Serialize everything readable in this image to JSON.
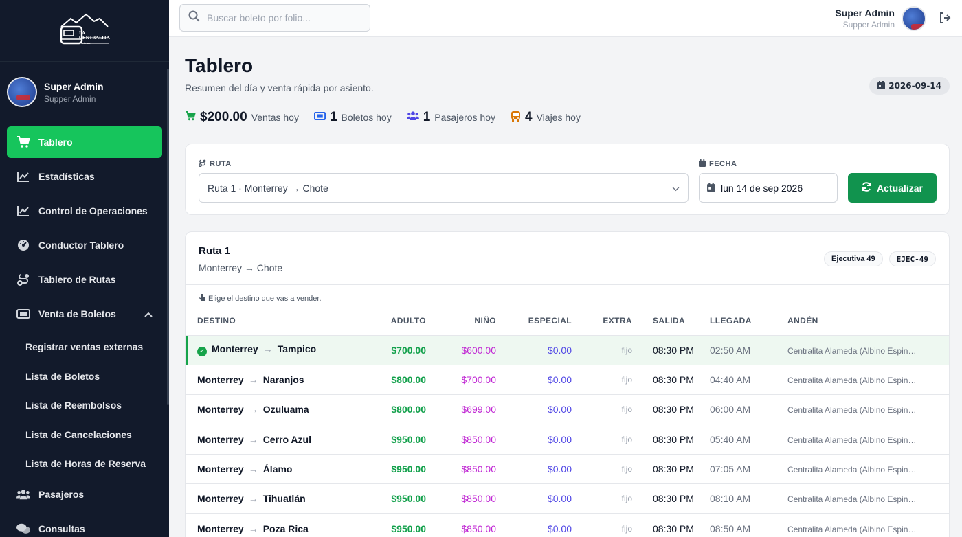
{
  "brand": {
    "logo_text_1": "LA",
    "logo_text_2": "CENTRALITA",
    "logo_text_3": "Turismo"
  },
  "sidebar": {
    "user": {
      "name": "Super Admin",
      "role": "Supper Admin"
    },
    "items": [
      {
        "label": "Tablero",
        "icon": "cart-icon",
        "active": true
      },
      {
        "label": "Estadísticas",
        "icon": "chart-line-icon"
      },
      {
        "label": "Control de Operaciones",
        "icon": "chart-line-icon"
      },
      {
        "label": "Conductor Tablero",
        "icon": "gauge-icon"
      },
      {
        "label": "Tablero de Rutas",
        "icon": "route-icon"
      },
      {
        "label": "Venta de Boletos",
        "icon": "ticket-icon",
        "expanded": true
      }
    ],
    "sub_items": [
      "Registrar ventas externas",
      "Lista de Boletos",
      "Lista de Reembolsos",
      "Lista de Cancelaciones",
      "Lista de Horas de Reserva"
    ],
    "items_after": [
      {
        "label": "Pasajeros",
        "icon": "users-icon"
      },
      {
        "label": "Consultas",
        "icon": "comments-icon"
      }
    ]
  },
  "topbar": {
    "search_placeholder": "Buscar boleto por folio...",
    "user_name": "Super Admin",
    "user_role": "Supper Admin"
  },
  "page": {
    "title": "Tablero",
    "subtitle": "Resumen del día y venta rápida por asiento.",
    "date": "2026-09-14"
  },
  "stats": [
    {
      "value": "$200.00",
      "label": "Ventas hoy",
      "icon": "cart-icon",
      "color": "#16a34a"
    },
    {
      "value": "1",
      "label": "Boletos hoy",
      "icon": "ticket-icon",
      "color": "#2563eb"
    },
    {
      "value": "1",
      "label": "Pasajeros hoy",
      "icon": "users-icon",
      "color": "#4f46e5"
    },
    {
      "value": "4",
      "label": "Viajes hoy",
      "icon": "bus-icon",
      "color": "#d97706"
    }
  ],
  "filters": {
    "route_label": "RUTA",
    "route_value": "Ruta 1 · Monterrey → Chote",
    "date_label": "FECHA",
    "date_value": "lun 14 de sep 2026",
    "update_button": "Actualizar"
  },
  "route": {
    "name": "Ruta 1",
    "path": "Monterrey → Chote",
    "badge_type": "Ejecutiva 49",
    "badge_code": "EJEC-49",
    "hint": "Elige el destino que vas a vender."
  },
  "table": {
    "headers": [
      "DESTINO",
      "ADULTO",
      "NIÑO",
      "ESPECIAL",
      "EXTRA",
      "SALIDA",
      "LLEGADA",
      "ANDÉN"
    ],
    "rows": [
      {
        "from": "Monterrey",
        "to": "Tampico",
        "adulto": "$700.00",
        "nino": "$600.00",
        "especial": "$0.00",
        "extra": "fijo",
        "salida": "08:30 PM",
        "llegada": "02:50 AM",
        "anden": "Centralita Alameda (Albino Espinoza)",
        "selected": true
      },
      {
        "from": "Monterrey",
        "to": "Naranjos",
        "adulto": "$800.00",
        "nino": "$700.00",
        "especial": "$0.00",
        "extra": "fijo",
        "salida": "08:30 PM",
        "llegada": "04:40 AM",
        "anden": "Centralita Alameda (Albino Espinoza)"
      },
      {
        "from": "Monterrey",
        "to": "Ozuluama",
        "adulto": "$800.00",
        "nino": "$699.00",
        "especial": "$0.00",
        "extra": "fijo",
        "salida": "08:30 PM",
        "llegada": "06:00 AM",
        "anden": "Centralita Alameda (Albino Espinoza)"
      },
      {
        "from": "Monterrey",
        "to": "Cerro Azul",
        "adulto": "$950.00",
        "nino": "$850.00",
        "especial": "$0.00",
        "extra": "fijo",
        "salida": "08:30 PM",
        "llegada": "05:40 AM",
        "anden": "Centralita Alameda (Albino Espinoza)"
      },
      {
        "from": "Monterrey",
        "to": "Álamo",
        "adulto": "$950.00",
        "nino": "$850.00",
        "especial": "$0.00",
        "extra": "fijo",
        "salida": "08:30 PM",
        "llegada": "07:05 AM",
        "anden": "Centralita Alameda (Albino Espinoza)"
      },
      {
        "from": "Monterrey",
        "to": "Tihuatlán",
        "adulto": "$950.00",
        "nino": "$850.00",
        "especial": "$0.00",
        "extra": "fijo",
        "salida": "08:30 PM",
        "llegada": "08:10 AM",
        "anden": "Centralita Alameda (Albino Espinoza)"
      },
      {
        "from": "Monterrey",
        "to": "Poza Rica",
        "adulto": "$950.00",
        "nino": "$850.00",
        "especial": "$0.00",
        "extra": "fijo",
        "salida": "08:30 PM",
        "llegada": "08:50 AM",
        "anden": "Centralita Alameda (Albino Espinoza)"
      }
    ]
  }
}
